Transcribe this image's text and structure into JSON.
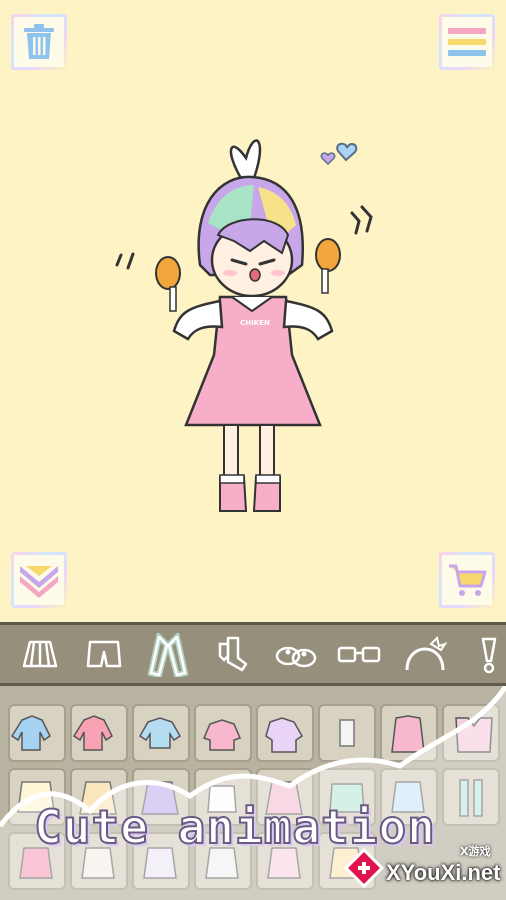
{
  "top_bar": {
    "trash_icon": "trash-icon",
    "menu_icon": "menu-lines-icon"
  },
  "character": {
    "shirt_text": "CHIKEN"
  },
  "bottom_buttons": {
    "collapse_icon": "double-chevron-down-icon",
    "cart_icon": "shopping-cart-icon"
  },
  "tabs": [
    {
      "icon": "skirt-icon",
      "active": false
    },
    {
      "icon": "shorts-icon",
      "active": false
    },
    {
      "icon": "dress-icon",
      "active": true
    },
    {
      "icon": "socks-icon",
      "active": false
    },
    {
      "icon": "shoes-icon",
      "active": false
    },
    {
      "icon": "glasses-icon",
      "active": false
    },
    {
      "icon": "headband-icon",
      "active": false
    },
    {
      "icon": "accessory-icon",
      "active": false
    }
  ],
  "banner": {
    "text": "Cute animation"
  },
  "watermark": {
    "site": "XYouXi.net",
    "small": "X游戏"
  },
  "colors": {
    "background": "#fdf3c4",
    "tabbar": "#958f7b",
    "grid": "#b8b3a1",
    "dress": "#f7aec8"
  }
}
